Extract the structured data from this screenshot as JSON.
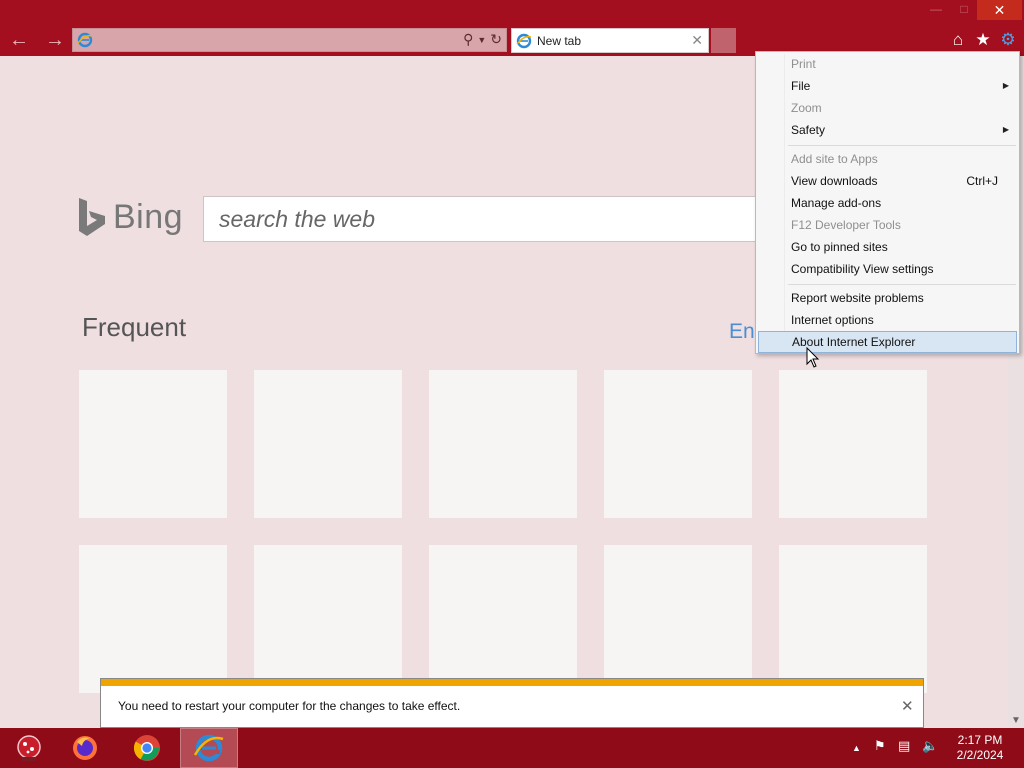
{
  "browser": {
    "tab_label": "New tab",
    "address_value": ""
  },
  "page": {
    "bing_text": "Bing",
    "search_placeholder": "search the web",
    "frequent_heading": "Frequent",
    "enable_link": "Ena"
  },
  "menu": {
    "items": [
      {
        "label": "Print",
        "disabled": true
      },
      {
        "label": "File",
        "submenu": true
      },
      {
        "label": "Zoom",
        "disabled": true
      },
      {
        "label": "Safety",
        "submenu": true
      },
      {
        "label": "Add site to Apps",
        "disabled": true
      },
      {
        "label": "View downloads",
        "shortcut": "Ctrl+J"
      },
      {
        "label": "Manage add-ons"
      },
      {
        "label": "F12 Developer Tools",
        "disabled": true
      },
      {
        "label": "Go to pinned sites"
      },
      {
        "label": "Compatibility View settings"
      },
      {
        "label": "Report website problems"
      },
      {
        "label": "Internet options"
      },
      {
        "label": "About Internet Explorer",
        "highlighted": true
      }
    ]
  },
  "notification": {
    "text": "You need to restart your computer for the changes to take effect."
  },
  "taskbar": {
    "time": "2:17 PM",
    "date": "2/2/2024",
    "apps": [
      "snow-globe-icon",
      "firefox-icon",
      "chrome-icon",
      "internet-explorer-icon"
    ]
  },
  "colors": {
    "titlebar": "#a30f1e",
    "taskbar": "#8e0b17",
    "notification_stripe": "#f0a400",
    "menu_highlight": "#d8e6f3"
  }
}
